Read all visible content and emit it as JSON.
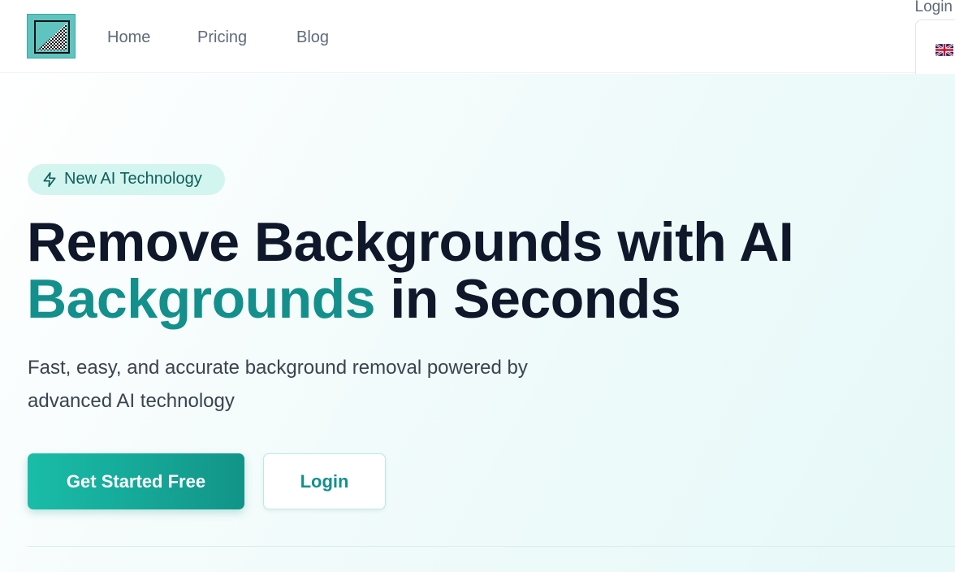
{
  "header": {
    "nav": {
      "home": "Home",
      "pricing": "Pricing",
      "blog": "Blog"
    },
    "login_label": "Login",
    "language_flag": "uk-flag"
  },
  "hero": {
    "badge": {
      "icon": "lightning-icon",
      "label": "New AI Technology"
    },
    "headline_line1": "Remove Backgrounds with AI",
    "headline_accent": "Backgrounds",
    "headline_line2_rest": " in Seconds",
    "subtitle_line1": "Fast, easy, and accurate background removal powered by",
    "subtitle_line2": "advanced AI technology",
    "cta_primary": "Get Started Free",
    "cta_secondary": "Login"
  },
  "colors": {
    "accent": "#13908c",
    "primary_button_start": "#19bda8",
    "primary_button_end": "#129488",
    "badge_bg": "#d3f5ef",
    "headline": "#0f172a"
  }
}
